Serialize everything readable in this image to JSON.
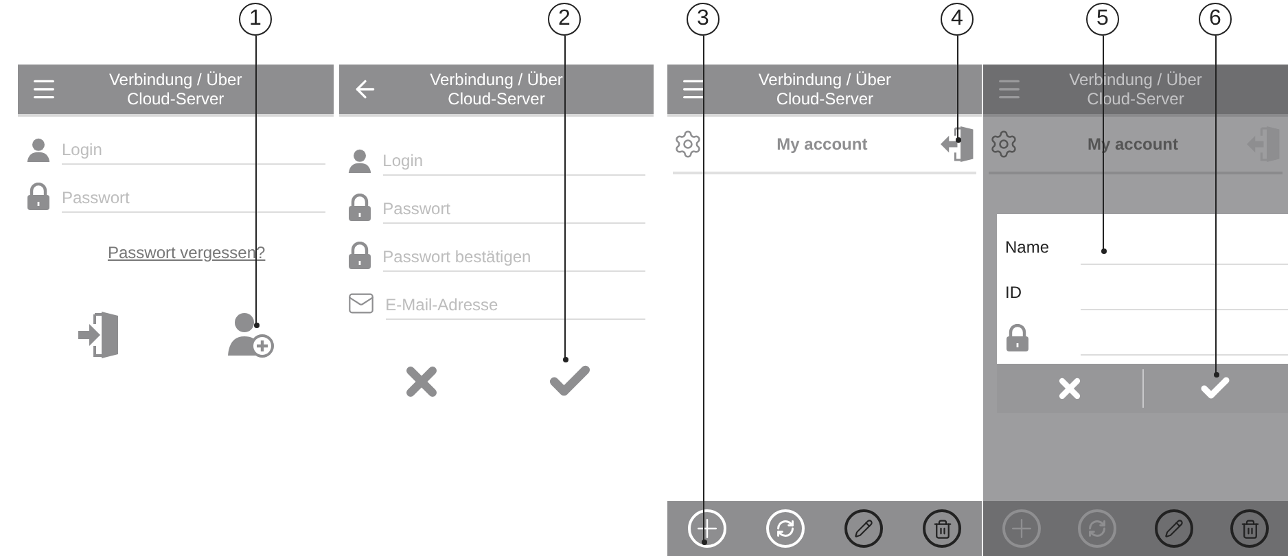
{
  "callouts": [
    {
      "number": "1"
    },
    {
      "number": "2"
    },
    {
      "number": "3"
    },
    {
      "number": "4"
    },
    {
      "number": "5"
    },
    {
      "number": "6"
    }
  ],
  "screens": [
    {
      "kind": "login",
      "dimmed": false,
      "title_lines": [
        "Verbindung / Über",
        "Cloud-Server"
      ],
      "fields": [
        {
          "kind": "person",
          "placeholder": "Login"
        },
        {
          "kind": "lock",
          "placeholder": "Passwort"
        }
      ],
      "link": "Passwort vergessen?"
    },
    {
      "kind": "register",
      "dimmed": false,
      "title_lines": [
        "Verbindung / Über",
        "Cloud-Server"
      ],
      "fields": [
        {
          "kind": "person",
          "placeholder": "Login"
        },
        {
          "kind": "lock",
          "placeholder": "Passwort"
        },
        {
          "kind": "lock",
          "placeholder": "Passwort bestätigen"
        },
        {
          "kind": "mail",
          "placeholder": "E-Mail-Adresse"
        }
      ]
    },
    {
      "kind": "account",
      "dimmed": false,
      "title_lines": [
        "Verbindung / Über",
        "Cloud-Server"
      ],
      "account": "My account",
      "toolbar": [
        {
          "kind": "add",
          "disabled": false
        },
        {
          "kind": "sync",
          "disabled": false
        },
        {
          "kind": "edit",
          "disabled": false
        },
        {
          "kind": "delete",
          "disabled": false
        }
      ]
    },
    {
      "kind": "account",
      "dimmed": true,
      "title_lines": [
        "Verbindung / Über",
        "Cloud-Server"
      ],
      "account": "My account",
      "dialog": {
        "fields": [
          {
            "kind": "text",
            "label": "Name"
          },
          {
            "kind": "text",
            "label": "ID"
          },
          {
            "kind": "lock"
          }
        ]
      },
      "toolbar": [
        {
          "kind": "add",
          "disabled": true
        },
        {
          "kind": "sync",
          "disabled": true
        },
        {
          "kind": "edit",
          "disabled": false
        },
        {
          "kind": "delete",
          "disabled": false
        }
      ]
    }
  ]
}
